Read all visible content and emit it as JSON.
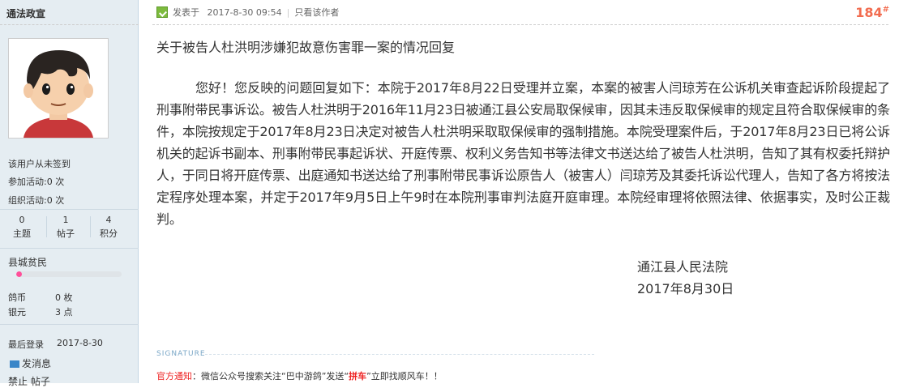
{
  "sidebar": {
    "username": "通法政宣",
    "signin_status": "该用户从未签到",
    "activity_join_label": "参加活动:0 次",
    "activity_org_label": "组织活动:0 次",
    "stats": [
      {
        "value": "0",
        "label": "主题"
      },
      {
        "value": "1",
        "label": "帖子"
      },
      {
        "value": "4",
        "label": "积分"
      }
    ],
    "level": "县城贫民",
    "level_progress": 0.05,
    "coins_label": "鸽币",
    "coins_value": "0 枚",
    "silver_label": "银元",
    "silver_value": "3 点",
    "last_login_label": "最后登录",
    "last_login_value": "2017-8-30",
    "send_message": "发消息",
    "bottom_partial": "禁止 帖子"
  },
  "post": {
    "posted_label": "发表于",
    "posted_time": "2017-8-30 09:54",
    "only_author": "只看该作者",
    "floor": "184",
    "floor_mark": "#",
    "title": "关于被告人杜洪明涉嫌犯故意伤害罪一案的情况回复",
    "body": "您好！您反映的问题回复如下：本院于2017年8月22日受理并立案，本案的被害人闫琼芳在公诉机关审查起诉阶段提起了刑事附带民事诉讼。被告人杜洪明于2016年11月23日被通江县公安局取保候审，因其未违反取保候审的规定且符合取保候审的条件，本院按规定于2017年8月23日决定对被告人杜洪明采取取保候审的强制措施。本院受理案件后，于2017年8月23日已将公诉机关的起诉书副本、刑事附带民事起诉状、开庭传票、权利义务告知书等法律文书送达给了被告人杜洪明，告知了其有权委托辩护人，于同日将开庭传票、出庭通知书送达给了刑事附带民事诉讼原告人（被害人）闫琼芳及其委托诉讼代理人，告知了各方将按法定程序处理本案，并定于2017年9月5日上午9时在本院刑事审判法庭开庭审理。本院经审理将依照法律、依据事实，及时公正裁判。",
    "signer_org": "通江县人民法院",
    "signer_date": "2017年8月30日",
    "signature_label": "SIGNATURE",
    "notice_prefix": "官方通知",
    "notice_text_1": "：微信公众号搜索关注“巴中游鸽”发送“",
    "notice_highlight": "拼车",
    "notice_text_2": "”立即找顺风车！！"
  },
  "colors": {
    "sidebar_bg": "#e5edf2",
    "floor": "#f26c4f",
    "notice_red": "#ee2222",
    "level_bar": "#ff4f9a"
  }
}
